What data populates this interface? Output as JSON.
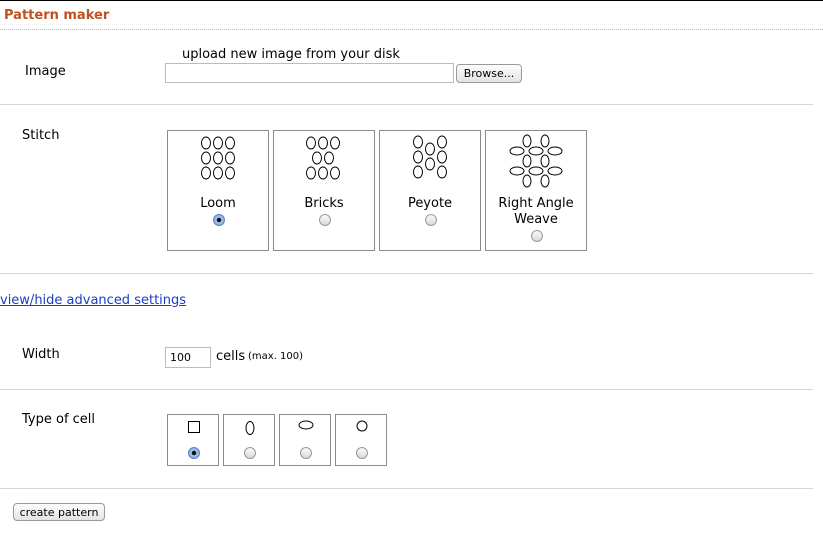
{
  "header": {
    "title": "Pattern maker"
  },
  "image_row": {
    "label": "Image",
    "upload_hint": "upload new image from your disk",
    "file_value": "",
    "browse_label": "Browse..."
  },
  "stitch_row": {
    "label": "Stitch",
    "options": [
      {
        "name": "Loom",
        "selected": true,
        "icon": "loom-pattern-icon"
      },
      {
        "name": "Bricks",
        "selected": false,
        "icon": "bricks-pattern-icon"
      },
      {
        "name": "Peyote",
        "selected": false,
        "icon": "peyote-pattern-icon"
      },
      {
        "name": "Right Angle Weave",
        "name_line1": "Right Angle",
        "name_line2": "Weave",
        "selected": false,
        "icon": "right-angle-weave-pattern-icon"
      }
    ]
  },
  "advanced_link": "view/hide advanced settings",
  "width_row": {
    "label": "Width",
    "value": "100",
    "unit": "cells",
    "hint": "(max. 100)"
  },
  "cell_row": {
    "label": "Type of cell",
    "options": [
      {
        "icon": "square-cell-icon",
        "selected": true
      },
      {
        "icon": "tall-oval-cell-icon",
        "selected": false
      },
      {
        "icon": "wide-oval-cell-icon",
        "selected": false
      },
      {
        "icon": "circle-cell-icon",
        "selected": false
      }
    ]
  },
  "create_button": "create pattern"
}
